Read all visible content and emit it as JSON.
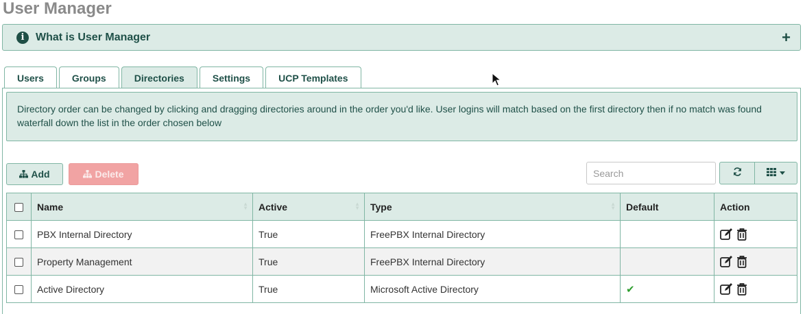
{
  "page": {
    "title": "User Manager"
  },
  "info_panel": {
    "title": "What is User Manager",
    "expand_symbol": "+"
  },
  "tabs": [
    {
      "label": "Users",
      "active": false
    },
    {
      "label": "Groups",
      "active": false
    },
    {
      "label": "Directories",
      "active": true
    },
    {
      "label": "Settings",
      "active": false
    },
    {
      "label": "UCP Templates",
      "active": false
    }
  ],
  "notice": {
    "text": "Directory order can be changed by clicking and dragging directories around in the order you'd like. User logins will match based on the first directory then if no match was found waterfall down the list in the order chosen below"
  },
  "toolbar": {
    "add_label": "Add",
    "delete_label": "Delete",
    "search_placeholder": "Search",
    "search_value": ""
  },
  "table": {
    "columns": [
      "Name",
      "Active",
      "Type",
      "Default",
      "Action"
    ],
    "rows": [
      {
        "name": "PBX Internal Directory",
        "active": "True",
        "type": "FreePBX Internal Directory",
        "default": false
      },
      {
        "name": "Property Management",
        "active": "True",
        "type": "FreePBX Internal Directory",
        "default": false
      },
      {
        "name": "Active Directory",
        "active": "True",
        "type": "Microsoft Active Directory",
        "default": true
      }
    ]
  },
  "icons": {
    "info": "info-circle-icon",
    "add": "sitemap-icon",
    "delete": "sitemap-icon",
    "refresh": "refresh-icon",
    "columns": "grid-icon",
    "edit": "edit-icon",
    "trash": "trash-icon",
    "default": "check-icon"
  },
  "colors": {
    "accent_bg": "#dcebe6",
    "accent_border": "#7fb5a3",
    "accent_text": "#1f5048",
    "delete_bg": "#f1a3a3",
    "check": "#2e9e2e"
  }
}
